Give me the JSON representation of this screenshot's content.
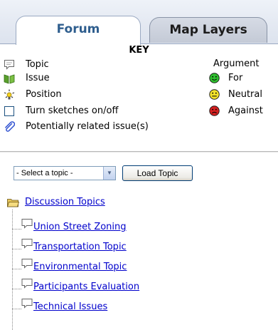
{
  "tabs": [
    {
      "label": "Forum",
      "active": true
    },
    {
      "label": "Map Layers",
      "active": false
    }
  ],
  "key": {
    "title": "KEY",
    "items": [
      {
        "icon": "speech-bubble-icon",
        "label": "Topic"
      },
      {
        "icon": "book-icon",
        "label": "Issue"
      },
      {
        "icon": "lightbulb-icon",
        "label": "Position"
      },
      {
        "icon": "checkbox-icon",
        "label": "Turn sketches on/off"
      },
      {
        "icon": "paperclip-icon",
        "label": "Potentially related issue(s)"
      }
    ],
    "argument_title": "Argument",
    "arguments": [
      {
        "icon": "smiley-for-icon",
        "label": "For",
        "color": "#2fbf2f"
      },
      {
        "icon": "smiley-neutral-icon",
        "label": "Neutral",
        "color": "#f2e22a"
      },
      {
        "icon": "smiley-against-icon",
        "label": "Against",
        "color": "#d42020"
      }
    ]
  },
  "controls": {
    "select_value": "- Select a topic -",
    "load_button": "Load Topic"
  },
  "tree": {
    "root": "Discussion Topics",
    "items": [
      "Union Street Zoning",
      "Transportation Topic",
      "Environmental Topic",
      "Participants Evaluation",
      "Technical Issues"
    ]
  }
}
